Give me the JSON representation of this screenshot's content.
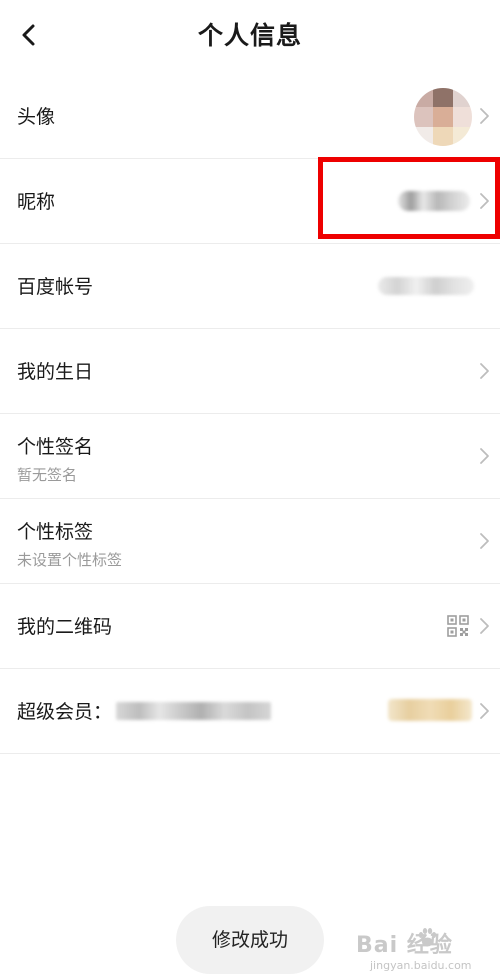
{
  "header": {
    "title": "个人信息"
  },
  "rows": [
    {
      "label": "头像"
    },
    {
      "label": "昵称"
    },
    {
      "label": "百度帐号"
    },
    {
      "label": "我的生日"
    },
    {
      "label": "个性签名",
      "subtitle": "暂无签名"
    },
    {
      "label": "个性标签",
      "subtitle": "未设置个性标签"
    },
    {
      "label": "我的二维码"
    },
    {
      "label": "超级会员："
    }
  ],
  "toast": {
    "text": "修改成功"
  },
  "watermark": {
    "brand": "Bai  经验",
    "url": "jingyan.baidu.com"
  },
  "icons": {
    "back": "chevron-left-icon",
    "row_arrow": "chevron-right-icon",
    "qr": "qr-code-icon"
  },
  "colors": {
    "highlight_box": "#ee0000",
    "divider": "#ececec",
    "subtitle": "#9a9a9a",
    "toast_bg": "#f1f1f1"
  }
}
